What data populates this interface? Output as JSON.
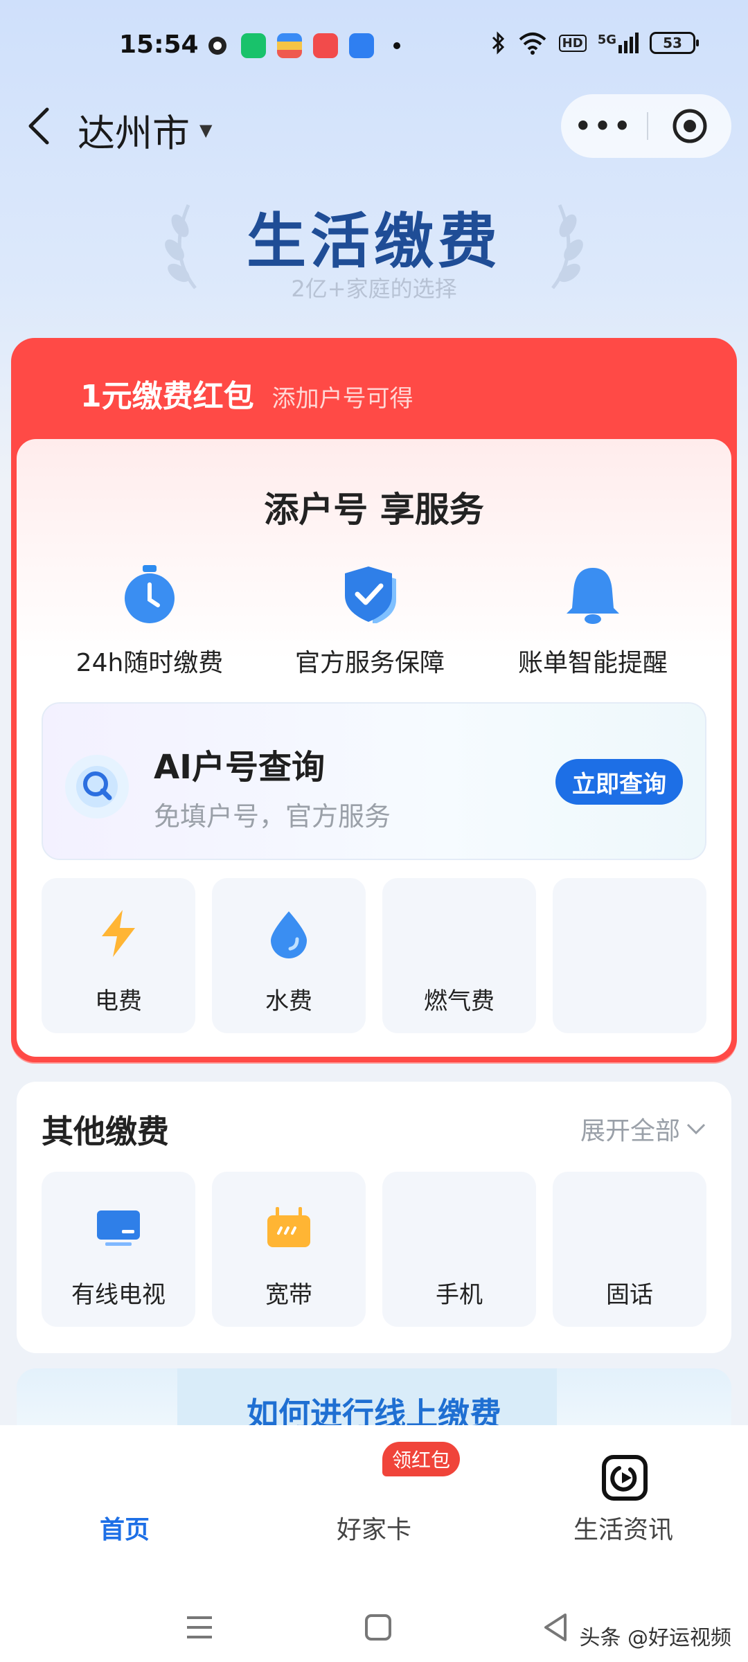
{
  "status": {
    "time": "15:54",
    "battery": "53",
    "signal": "5G",
    "hd": "HD"
  },
  "nav": {
    "city": "达州市",
    "more_icon": "more-dots-icon",
    "target_icon": "target-icon"
  },
  "hero": {
    "title": "生活缴费",
    "subtitle": "2亿+家庭的选择"
  },
  "promo": {
    "title": "1元缴费红包",
    "subtitle": "添加户号可得"
  },
  "add_account": {
    "title": "添户号 享服务",
    "features": [
      {
        "label": "24h随时缴费",
        "icon": "clock-icon"
      },
      {
        "label": "官方服务保障",
        "icon": "shield-check-icon"
      },
      {
        "label": "账单智能提醒",
        "icon": "bell-icon"
      }
    ]
  },
  "ai_query": {
    "title": "AI户号查询",
    "subtitle": "免填户号，官方服务",
    "button": "立即查询"
  },
  "utilities": [
    {
      "label": "电费",
      "icon": "lightning-icon"
    },
    {
      "label": "水费",
      "icon": "water-drop-icon"
    },
    {
      "label": "燃气费",
      "icon": "gas-flame-icon"
    },
    {
      "label": "",
      "icon": ""
    }
  ],
  "other": {
    "title": "其他缴费",
    "expand": "展开全部",
    "items": [
      {
        "label": "有线电视",
        "icon": "tv-icon"
      },
      {
        "label": "宽带",
        "icon": "broadband-icon"
      },
      {
        "label": "手机",
        "icon": "phone-icon"
      },
      {
        "label": "固话",
        "icon": "landline-icon"
      }
    ]
  },
  "how_to": "如何进行线上缴费",
  "tabs": [
    {
      "label": "首页",
      "active": true
    },
    {
      "label": "好家卡",
      "badge": "领红包"
    },
    {
      "label": "生活资讯"
    }
  ],
  "watermark": "头条 @好运视频",
  "colors": {
    "primary": "#1d6fe6",
    "promo_red": "#ff4a46",
    "hero_title": "#1f4d96"
  }
}
